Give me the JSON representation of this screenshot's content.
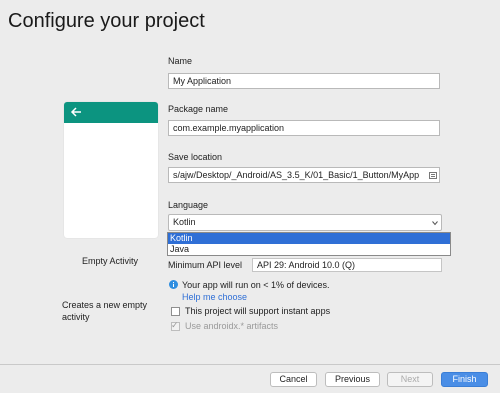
{
  "page": {
    "title": "Configure your project"
  },
  "activity": {
    "name": "Empty Activity",
    "description": "Creates a new empty activity"
  },
  "form": {
    "name_label": "Name",
    "name_value": "My Application",
    "package_label": "Package name",
    "package_value": "com.example.myapplication",
    "save_label": "Save location",
    "save_value": "s/ajw/Desktop/_Android/AS_3.5_K/01_Basic/1_Button/MyApp",
    "language_label": "Language",
    "language_value": "Kotlin",
    "language_options": [
      "Kotlin",
      "Java"
    ],
    "api_label": "Minimum API level",
    "api_value": "API 29: Android 10.0 (Q)",
    "info_text": "Your app will run on < 1% of devices.",
    "help_link": "Help me choose",
    "instant_apps_label": "This project will support instant apps",
    "androidx_label": "Use androidx.* artifacts"
  },
  "footer": {
    "cancel": "Cancel",
    "previous": "Previous",
    "next": "Next",
    "finish": "Finish"
  },
  "colors": {
    "accent": "#0c9480",
    "selection": "#2f6fd6",
    "primary_button": "#4a8ee6"
  }
}
